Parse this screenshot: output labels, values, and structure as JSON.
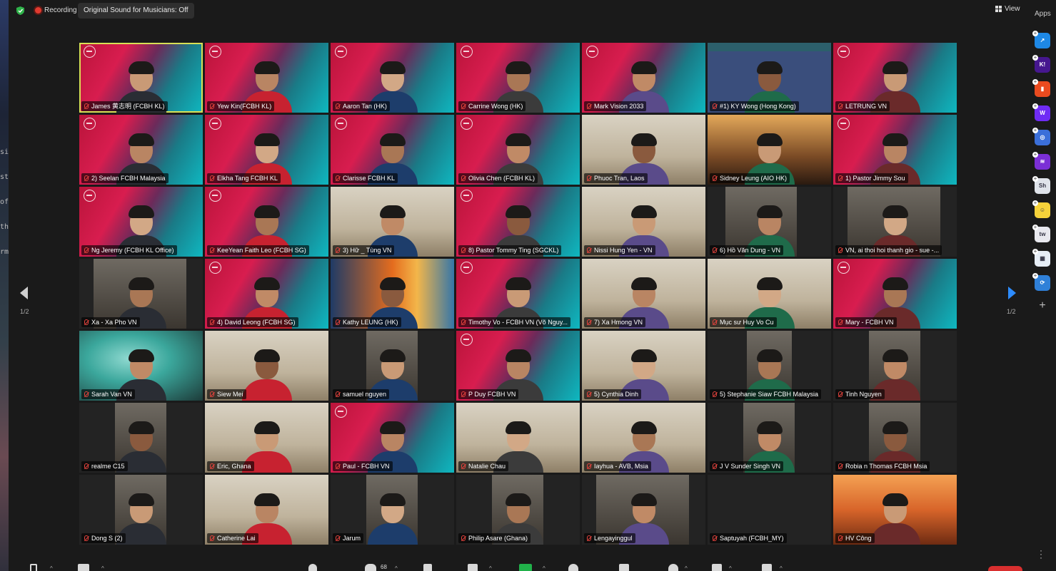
{
  "desktop_left_code": [
    "si",
    "st",
    "of",
    "th",
    "rm"
  ],
  "topbar": {
    "recording_label": "Recording",
    "original_sound": "Original Sound for Musicians: Off",
    "view_label": "View",
    "apps_label": "Apps"
  },
  "pagination": {
    "left_page": "1/2",
    "right_page": "1/2"
  },
  "participants": [
    {
      "name": "James 黄志明 (FCBH KL)",
      "bg": "brand",
      "active": true
    },
    {
      "name": "Yew Kin(FCBH KL)",
      "bg": "brand"
    },
    {
      "name": "Aaron Tan (HK)",
      "bg": "brand"
    },
    {
      "name": "Carrine Wong (HK)",
      "bg": "brand"
    },
    {
      "name": "Mark Vision 2033",
      "bg": "brand"
    },
    {
      "name": "#1) KY Wong (Hong Kong)",
      "bg": "map"
    },
    {
      "name": "LETRUNG VN",
      "bg": "brand"
    },
    {
      "name": "2) Seelan FCBH Malaysia",
      "bg": "brand"
    },
    {
      "name": "Elkha Tang FCBH KL",
      "bg": "brand"
    },
    {
      "name": "Clarisse FCBH KL",
      "bg": "brand"
    },
    {
      "name": "Olivia Chen (FCBH KL)",
      "bg": "brand"
    },
    {
      "name": "Phuoc Tran, Laos",
      "bg": "room"
    },
    {
      "name": "Sidney Leung (AIO HK)",
      "bg": "cross"
    },
    {
      "name": "1) Pastor Jimmy Sou",
      "bg": "brand"
    },
    {
      "name": "Ng Jeremy (FCBH KL Office)",
      "bg": "brand"
    },
    {
      "name": "KeeYean Faith Leo (FCBH SG)",
      "bg": "brand"
    },
    {
      "name": "3) Hữ _ Tùng VN",
      "bg": "room"
    },
    {
      "name": "8) Pastor Tommy Ting (SGCKL)",
      "bg": "brand"
    },
    {
      "name": "Nissi Hung Yen - VN",
      "bg": "room"
    },
    {
      "name": "6) Hồ Văn Dung - VN",
      "bg": "dark",
      "inset": [
        25,
        125
      ]
    },
    {
      "name": "VN, ai thoi hoi thanh gio - sue -...",
      "bg": "dark",
      "inset": [
        20,
        150
      ]
    },
    {
      "name": "Xa - Xa Pho VN",
      "bg": "dark",
      "inset": [
        20,
        150
      ]
    },
    {
      "name": "4) David Leong (FCBH SG)",
      "bg": "brand"
    },
    {
      "name": "Kathy LEUNG (HK)",
      "bg": "orange"
    },
    {
      "name": "Timothy Vo - FCBH VN (Võ Nguy...",
      "bg": "brand"
    },
    {
      "name": "7) Xa Hmong VN",
      "bg": "room"
    },
    {
      "name": "Mục sư Huy Vo Cu",
      "bg": "room"
    },
    {
      "name": "Mary - FCBH VN",
      "bg": "brand"
    },
    {
      "name": "Sarah Van VN",
      "bg": "green"
    },
    {
      "name": "Siew Mei",
      "bg": "room"
    },
    {
      "name": "samuel nguyen",
      "bg": "dark",
      "inset": [
        50,
        122
      ]
    },
    {
      "name": "P Duy FCBH VN",
      "bg": "brand"
    },
    {
      "name": "5) Cynthia Dinh",
      "bg": "room"
    },
    {
      "name": "5) Stephanie Siaw FCBH Malaysia",
      "bg": "dark",
      "inset": [
        55,
        118
      ]
    },
    {
      "name": "Tinh Nguyen",
      "bg": "dark",
      "inset": [
        50,
        122
      ]
    },
    {
      "name": "realme C15",
      "bg": "dark",
      "inset": [
        50,
        122
      ]
    },
    {
      "name": "Eric, Ghana",
      "bg": "room"
    },
    {
      "name": "Paul - FCBH VN",
      "bg": "brand"
    },
    {
      "name": "Natalie Chau",
      "bg": "room"
    },
    {
      "name": "Iayhua - AVB, Msia",
      "bg": "room"
    },
    {
      "name": "J V Sunder Singh VN",
      "bg": "dark",
      "inset": [
        50,
        122
      ]
    },
    {
      "name": "Robia n Thomas FCBH Msia",
      "bg": "dark",
      "inset": [
        50,
        122
      ]
    },
    {
      "name": "Dong S (2)",
      "bg": "dark",
      "inset": [
        50,
        122
      ]
    },
    {
      "name": "Catherine Lai",
      "bg": "room"
    },
    {
      "name": "Jarum",
      "bg": "dark",
      "inset": [
        50,
        122
      ]
    },
    {
      "name": "Philip Asare (Ghana)",
      "bg": "dark",
      "inset": [
        50,
        122
      ]
    },
    {
      "name": "Lengayinggul",
      "bg": "dark",
      "inset": [
        20,
        150
      ]
    },
    {
      "name": "Saptuyah (FCBH_MY)",
      "bg": "dark",
      "empty": true
    },
    {
      "name": "HV Công",
      "bg": "sunset"
    }
  ],
  "toolbar": {
    "participant_count": "68"
  },
  "apps": [
    {
      "name": "app-1",
      "color": "#1e88e5",
      "label": "↗"
    },
    {
      "name": "kahoot",
      "color": "#46178f",
      "label": "K!"
    },
    {
      "name": "app-3",
      "color": "#ea4b1f",
      "label": "▮"
    },
    {
      "name": "app-w",
      "color": "#6f2cf5",
      "label": "W"
    },
    {
      "name": "app-5",
      "color": "#3b6fd9",
      "label": "◎"
    },
    {
      "name": "app-6",
      "color": "#7b2fd6",
      "label": "≋"
    },
    {
      "name": "app-7",
      "color": "#dfe3ea",
      "label": "Sh"
    },
    {
      "name": "app-8",
      "color": "#f6d23a",
      "label": "☺"
    },
    {
      "name": "twine",
      "color": "#e8e8ee",
      "label": "tw"
    },
    {
      "name": "app-10",
      "color": "#e6edf5",
      "label": "▦"
    },
    {
      "name": "app-11",
      "color": "#2f80d8",
      "label": "⟳"
    }
  ]
}
